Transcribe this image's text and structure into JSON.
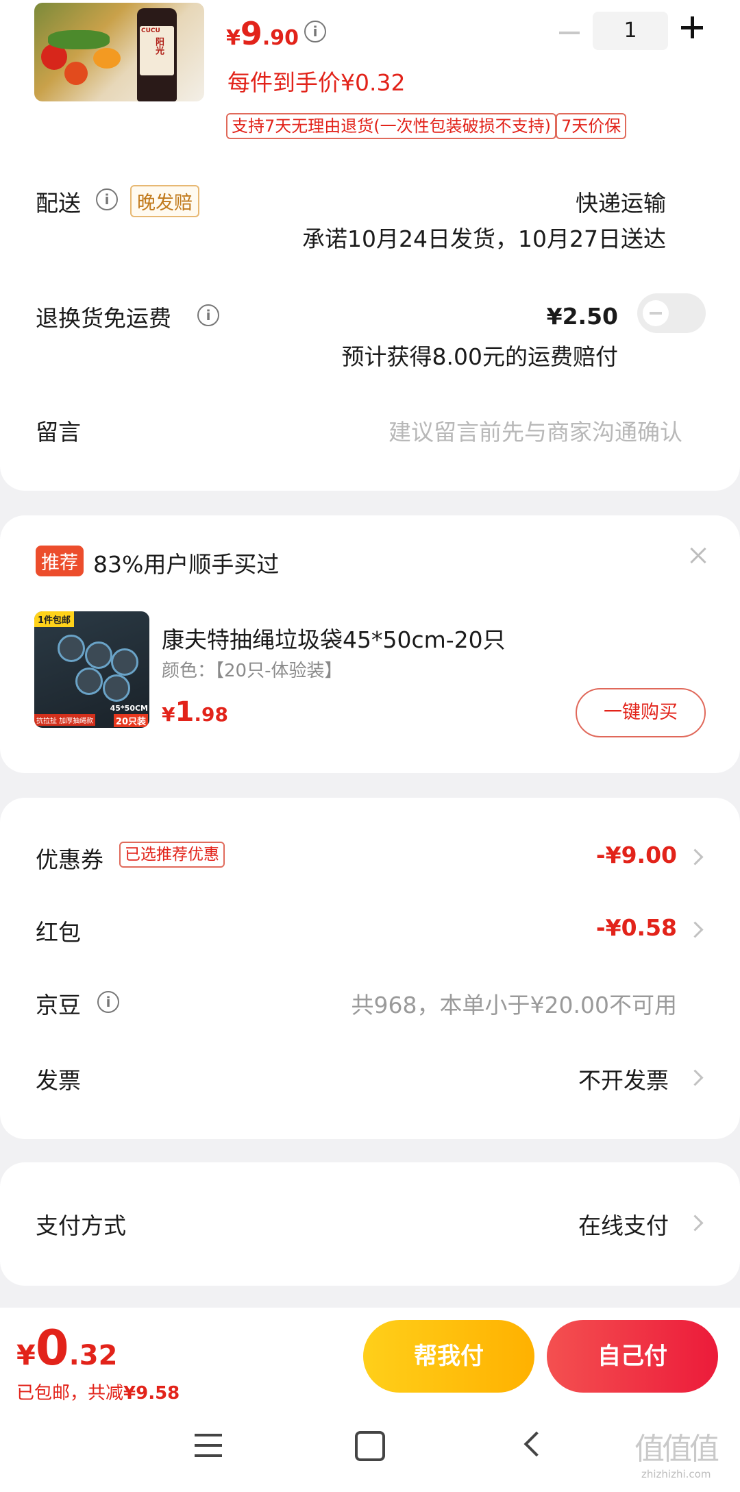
{
  "product": {
    "price_symbol": "¥",
    "price_int": "9",
    "price_dec": ".90",
    "per_item_price": "每件到手价¥0.32",
    "tag_return": "支持7天无理由退货(一次性包装破损不支持)",
    "tag_price_protect": "7天价保",
    "qty": "1",
    "image_label_brand": "CUCU",
    "image_label_name": "阳光"
  },
  "delivery": {
    "label": "配送",
    "badge": "晚发赔",
    "method": "快递运输",
    "promise": "承诺10月24日发货，10月27日送达"
  },
  "return_shipping": {
    "label": "退换货免运费",
    "price": "¥2.50",
    "note": "预计获得8.00元的运费赔付",
    "toggle_on": false
  },
  "message": {
    "label": "留言",
    "placeholder": "建议留言前先与商家沟通确认"
  },
  "recommend": {
    "badge": "推荐",
    "title": "83%用户顺手买过",
    "product_name": "康夫特抽绳垃圾袋45*50cm-20只",
    "product_spec": "颜色：【20只-体验装】",
    "price_symbol": "¥",
    "price_int": "1",
    "price_dec": ".98",
    "buy_button": "一键购买",
    "image_tag_top": "1件包邮",
    "image_tag_size": "45*50CM",
    "image_tag_count": "20只装",
    "image_tag_bottom": "抗拉扯 加厚抽绳款"
  },
  "discounts": {
    "coupon_label": "优惠券",
    "coupon_badge": "已选推荐优惠",
    "coupon_value": "-¥9.00",
    "redpacket_label": "红包",
    "redpacket_value": "-¥0.58",
    "jingdou_label": "京豆",
    "jingdou_value": "共968，本单小于¥20.00不可用",
    "invoice_label": "发票",
    "invoice_value": "不开发票"
  },
  "payment": {
    "label": "支付方式",
    "value": "在线支付"
  },
  "footer": {
    "total_symbol": "¥",
    "total_int": "0",
    "total_dec": ".32",
    "summary_prefix": "已包邮，共减",
    "summary_amount": "¥9.58",
    "help_pay": "帮我付",
    "self_pay": "自己付"
  },
  "watermark": "值",
  "watermark_url": "zhizhizhi.com",
  "colors": {
    "accent_red": "#e2231a",
    "help_pay_yellow": "#ffbf00",
    "self_pay_red": "#f0293a"
  }
}
